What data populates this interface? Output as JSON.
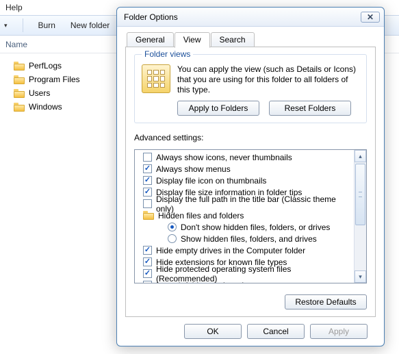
{
  "explorer": {
    "menu_help": "Help",
    "toolbar": {
      "burn": "Burn",
      "newfolder": "New folder"
    },
    "column_name": "Name",
    "files": [
      "PerfLogs",
      "Program Files",
      "Users",
      "Windows"
    ]
  },
  "dialog": {
    "title": "Folder Options",
    "tabs": {
      "general": "General",
      "view": "View",
      "search": "Search"
    },
    "folder_views": {
      "legend": "Folder views",
      "text": "You can apply the view (such as Details or Icons) that you are using for this folder to all folders of this type.",
      "apply": "Apply to Folders",
      "reset": "Reset Folders"
    },
    "advanced_label": "Advanced settings:",
    "advanced": [
      {
        "type": "cb",
        "checked": false,
        "level": 0,
        "label": "Always show icons, never thumbnails"
      },
      {
        "type": "cb",
        "checked": true,
        "level": 0,
        "label": "Always show menus"
      },
      {
        "type": "cb",
        "checked": true,
        "level": 0,
        "label": "Display file icon on thumbnails"
      },
      {
        "type": "cb",
        "checked": true,
        "level": 0,
        "label": "Display file size information in folder tips"
      },
      {
        "type": "cb",
        "checked": false,
        "level": 0,
        "label": "Display the full path in the title bar (Classic theme only)"
      },
      {
        "type": "folder",
        "level": 0,
        "label": "Hidden files and folders"
      },
      {
        "type": "rb",
        "checked": true,
        "level": 2,
        "label": "Don't show hidden files, folders, or drives"
      },
      {
        "type": "rb",
        "checked": false,
        "level": 2,
        "label": "Show hidden files, folders, and drives"
      },
      {
        "type": "cb",
        "checked": true,
        "level": 0,
        "label": "Hide empty drives in the Computer folder"
      },
      {
        "type": "cb",
        "checked": true,
        "level": 0,
        "label": "Hide extensions for known file types"
      },
      {
        "type": "cb",
        "checked": true,
        "level": 0,
        "label": "Hide protected operating system files (Recommended)"
      },
      {
        "type": "cb",
        "checked": false,
        "level": 0,
        "label": "Launch folder windows in a separate process"
      }
    ],
    "restore": "Restore Defaults",
    "ok": "OK",
    "cancel": "Cancel",
    "apply": "Apply"
  }
}
